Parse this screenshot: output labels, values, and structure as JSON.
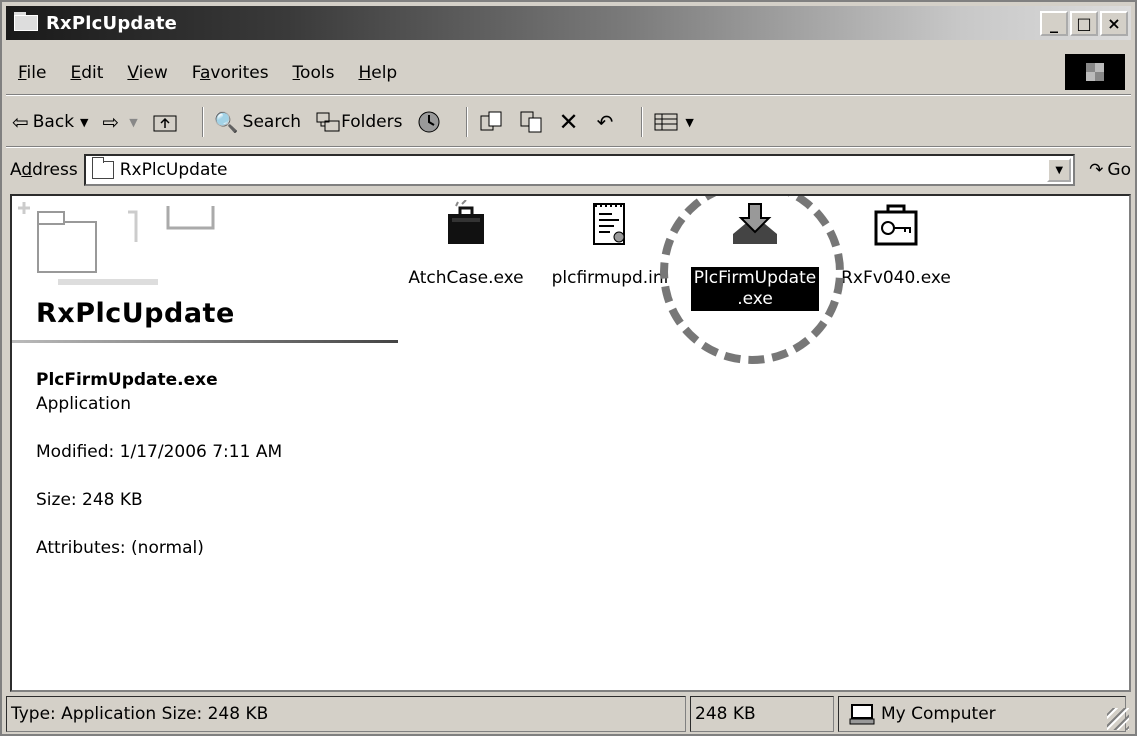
{
  "window": {
    "title": "RxPlcUpdate"
  },
  "title_buttons": [
    "_",
    "□",
    "×"
  ],
  "menu": [
    {
      "accel": "F",
      "rest": "ile"
    },
    {
      "accel": "E",
      "rest": "dit"
    },
    {
      "accel": "V",
      "rest": "iew"
    },
    {
      "pre": "F",
      "accel": "a",
      "rest": "vorites"
    },
    {
      "accel": "T",
      "rest": "ools"
    },
    {
      "accel": "H",
      "rest": "elp"
    }
  ],
  "toolbar": {
    "back": "Back",
    "search": "Search",
    "folders": "Folders"
  },
  "address": {
    "label_pre": "A",
    "label_accel": "d",
    "label_rest": "dress",
    "value": "RxPlcUpdate",
    "go": "Go"
  },
  "panel": {
    "folder_title": "RxPlcUpdate",
    "selected_name": "PlcFirmUpdate.exe",
    "selected_type": "Application",
    "modified": "Modified: 1/17/2006 7:11 AM",
    "size": "Size: 248 KB",
    "attributes": "Attributes: (normal)"
  },
  "files": [
    {
      "name": "AtchCase.exe",
      "icon": "briefcase-icon"
    },
    {
      "name": "plcfirmupd.ini",
      "icon": "ini-file-icon"
    },
    {
      "name_line1": "PlcFirmUpdate",
      "name_line2": ".exe",
      "icon": "download-install-icon",
      "selected": true
    },
    {
      "name": "RxFv040.exe",
      "icon": "key-lock-icon"
    }
  ],
  "status": {
    "type_size": "Type: Application Size: 248 KB",
    "size": "248 KB",
    "zone": "My Computer"
  }
}
